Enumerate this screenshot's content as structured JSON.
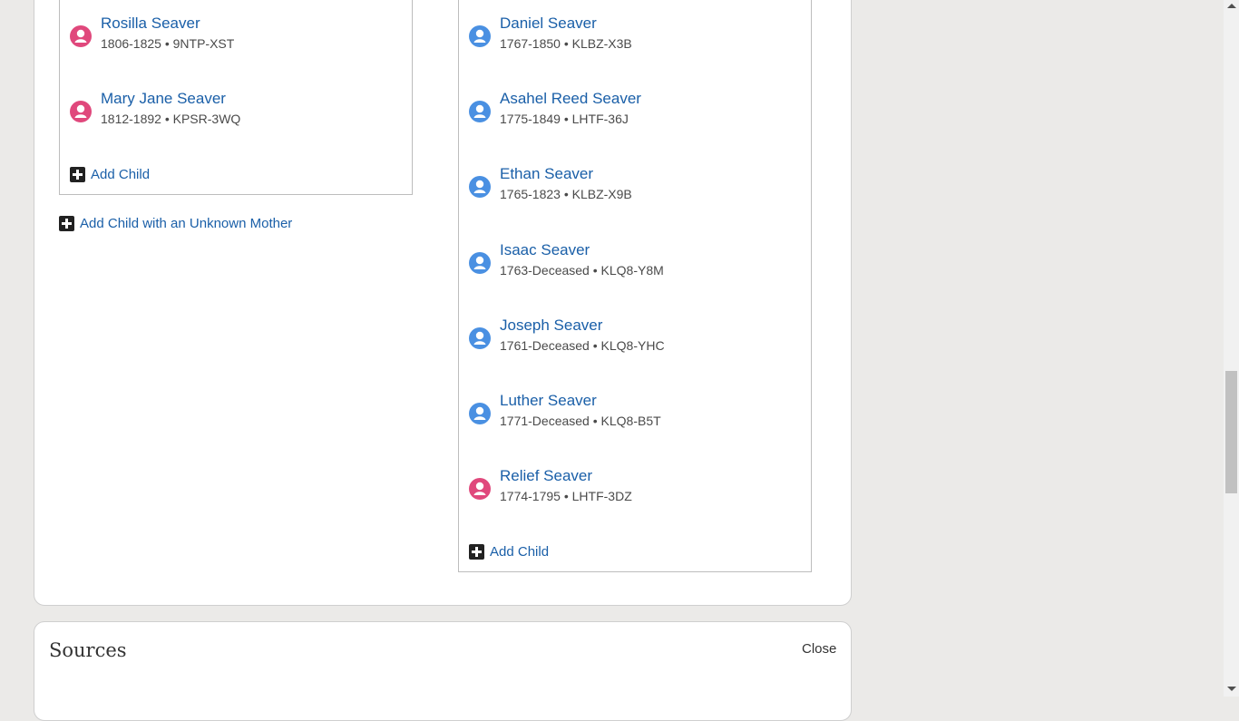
{
  "colors": {
    "link": "#1a5fa8",
    "male_avatar": "#4a90e2",
    "female_avatar": "#e0487c",
    "page_background": "#ebeae8"
  },
  "left_children": [
    {
      "name": "Rosilla Seaver",
      "meta": "1806-1825 • 9NTP-XST",
      "gender": "female",
      "icon": "female-person-icon"
    },
    {
      "name": "Mary Jane Seaver",
      "meta": "1812-1892 • KPSR-3WQ",
      "gender": "female",
      "icon": "female-person-icon"
    }
  ],
  "left_add_child": "Add Child",
  "add_child_unknown_mother": "Add Child with an Unknown Mother",
  "right_children": [
    {
      "name": "Daniel Seaver",
      "meta": "1767-1850 • KLBZ-X3B",
      "gender": "male",
      "icon": "male-person-icon"
    },
    {
      "name": "Asahel Reed Seaver",
      "meta": "1775-1849 • LHTF-36J",
      "gender": "male",
      "icon": "male-person-icon"
    },
    {
      "name": "Ethan Seaver",
      "meta": "1765-1823 • KLBZ-X9B",
      "gender": "male",
      "icon": "male-person-icon"
    },
    {
      "name": "Isaac Seaver",
      "meta": "1763-Deceased • KLQ8-Y8M",
      "gender": "male",
      "icon": "male-person-icon"
    },
    {
      "name": "Joseph Seaver",
      "meta": "1761-Deceased • KLQ8-YHC",
      "gender": "male",
      "icon": "male-person-icon"
    },
    {
      "name": "Luther Seaver",
      "meta": "1771-Deceased • KLQ8-B5T",
      "gender": "male",
      "icon": "male-person-icon"
    },
    {
      "name": "Relief Seaver",
      "meta": "1774-1795 • LHTF-3DZ",
      "gender": "female",
      "icon": "female-person-icon"
    }
  ],
  "right_add_child": "Add Child",
  "sources": {
    "title": "Sources",
    "close_label": "Close"
  }
}
